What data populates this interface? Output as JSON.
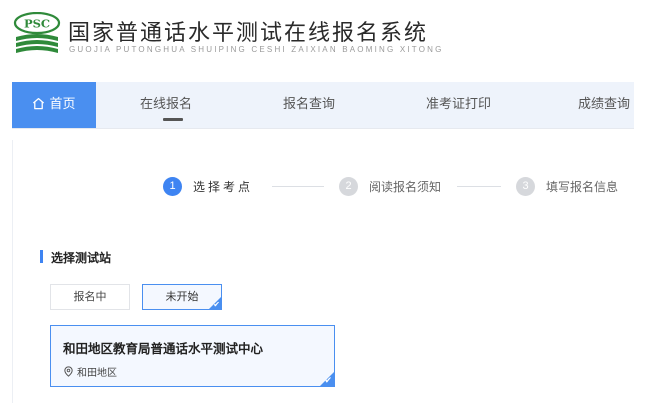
{
  "header": {
    "logo_text": "PSC",
    "title": "国家普通话水平测试在线报名系统",
    "subtitle": "GUOJIA PUTONGHUA SHUIPING CESHI ZAIXIAN BAOMING XITONG"
  },
  "nav": {
    "items": [
      {
        "label": "首页"
      },
      {
        "label": "在线报名"
      },
      {
        "label": "报名查询"
      },
      {
        "label": "准考证打印"
      },
      {
        "label": "成绩查询"
      }
    ]
  },
  "steps": [
    {
      "num": "1",
      "label": "选择考点"
    },
    {
      "num": "2",
      "label": "阅读报名须知"
    },
    {
      "num": "3",
      "label": "填写报名信息"
    }
  ],
  "section": {
    "title": "选择测试站"
  },
  "filters": [
    {
      "label": "报名中"
    },
    {
      "label": "未开始"
    }
  ],
  "station": {
    "name": "和田地区教育局普通话水平测试中心",
    "location": "和田地区"
  },
  "colors": {
    "accent": "#4a8ff0",
    "nav_bg": "#eef3fb",
    "step_active": "#3e84f2",
    "step_inactive": "#d6d8dc",
    "logo_green": "#2f8a3a"
  }
}
